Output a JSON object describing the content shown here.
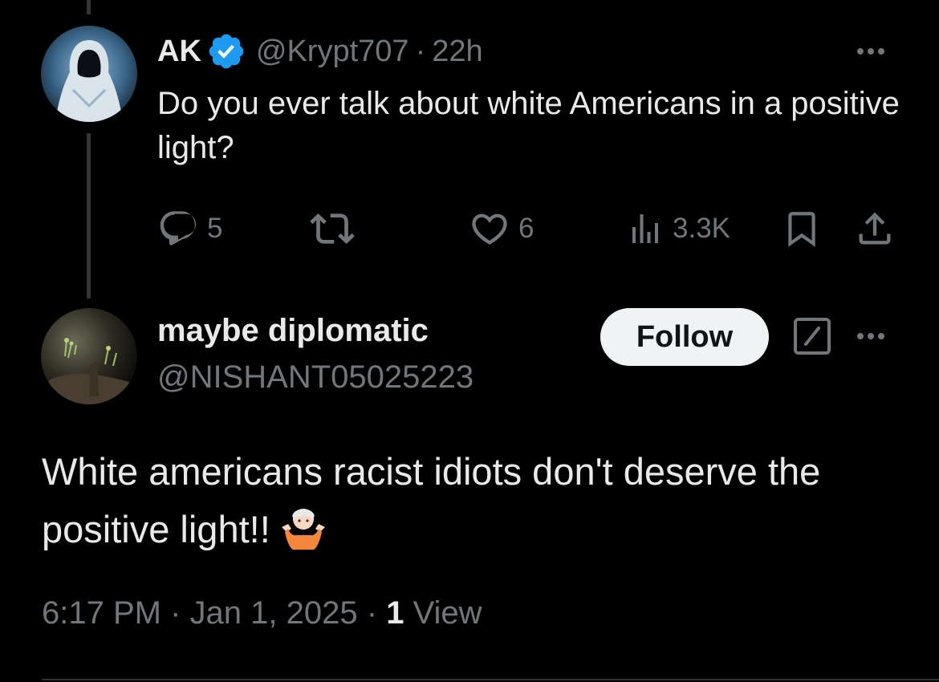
{
  "parent_tweet": {
    "display_name": "AK",
    "handle": "@Krypt707",
    "separator": "·",
    "time": "22h",
    "text": "Do you ever talk about white Americans in a positive light?",
    "actions": {
      "replies": "5",
      "reposts": "",
      "likes": "6",
      "views": "3.3K"
    }
  },
  "reply_tweet": {
    "display_name": "maybe diplomatic",
    "handle": "@NISHANT05025223",
    "follow_label": "Follow",
    "text": "White americans racist idiots don't deserve the positive light!!",
    "time": "6:17 PM",
    "date": "Jan 1, 2025",
    "separator": "·",
    "view_count": "1",
    "view_label": "View"
  },
  "colors": {
    "background": "#000000",
    "text_primary": "#e7e9ea",
    "text_secondary": "#71767b",
    "verified_blue": "#1d9bf0",
    "follow_bg": "#eff3f4"
  },
  "icons": [
    "reply-icon",
    "repost-icon",
    "like-icon",
    "views-icon",
    "bookmark-icon",
    "share-icon",
    "more-icon",
    "grok-icon",
    "verified-icon",
    "shrug-emoji"
  ]
}
